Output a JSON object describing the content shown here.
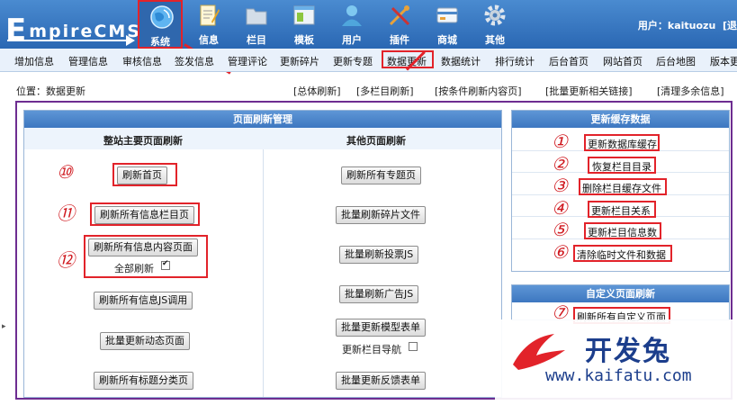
{
  "logo": {
    "first": "E",
    "rest": "mpireCMS"
  },
  "topnav": [
    {
      "label": "系统",
      "icon": "globe-icon"
    },
    {
      "label": "信息",
      "icon": "document-icon"
    },
    {
      "label": "栏目",
      "icon": "folder-icon"
    },
    {
      "label": "模板",
      "icon": "template-window-icon"
    },
    {
      "label": "用户",
      "icon": "user-icon"
    },
    {
      "label": "插件",
      "icon": "plugin-tools-icon"
    },
    {
      "label": "商城",
      "icon": "shop-card-icon"
    },
    {
      "label": "其他",
      "icon": "gear-icon"
    }
  ],
  "user": {
    "label": "用户：",
    "name": "kaituozu",
    "extra": "[退"
  },
  "subnav": [
    "增加信息",
    "管理信息",
    "审核信息",
    "签发信息",
    "管理评论",
    "更新碎片",
    "更新专题",
    "数据更新",
    "数据统计",
    "排行统计",
    "后台首页",
    "网站首页",
    "后台地图",
    "版本更"
  ],
  "breadcrumb": "位置：数据更新",
  "toplinks": [
    "[总体刷新]",
    "[多栏目刷新]",
    "[按条件刷新内容页]",
    "[批量更新相关链接]",
    "[清理多余信息]"
  ],
  "left": {
    "title": "页面刷新管理",
    "col1": "整站主要页面刷新",
    "col2": "其他页面刷新",
    "buttons_left": [
      "刷新首页",
      "刷新所有信息栏目页",
      "刷新所有信息内容页面",
      "刷新所有信息JS调用",
      "批量更新动态页面",
      "刷新所有标题分类页"
    ],
    "all_refresh": "全部刷新",
    "buttons_right": [
      "刷新所有专题页",
      "批量刷新碎片文件",
      "批量刷新投票JS",
      "批量刷新广告JS",
      "批量更新模型表单",
      "批量更新反馈表单"
    ],
    "nav_label": "更新栏目导航",
    "markers": [
      "⑩",
      "⑪",
      "⑫"
    ]
  },
  "right1": {
    "title": "更新缓存数据",
    "links": [
      "更新数据库缓存",
      "恢复栏目目录",
      "删除栏目缓存文件",
      "更新栏目关系",
      "更新栏目信息数",
      "清除临时文件和数据"
    ],
    "markers": [
      "①",
      "②",
      "③",
      "④",
      "⑤",
      "⑥"
    ]
  },
  "right2": {
    "title": "自定义页面刷新",
    "link": "刷新所有自定义页面",
    "marker": "⑦"
  },
  "watermark": {
    "text": "开发兔",
    "url": "www.kaifatu.com"
  },
  "colors": {
    "accent": "#e2232a",
    "frame": "#6d2d91",
    "header": "#3d77c0"
  }
}
